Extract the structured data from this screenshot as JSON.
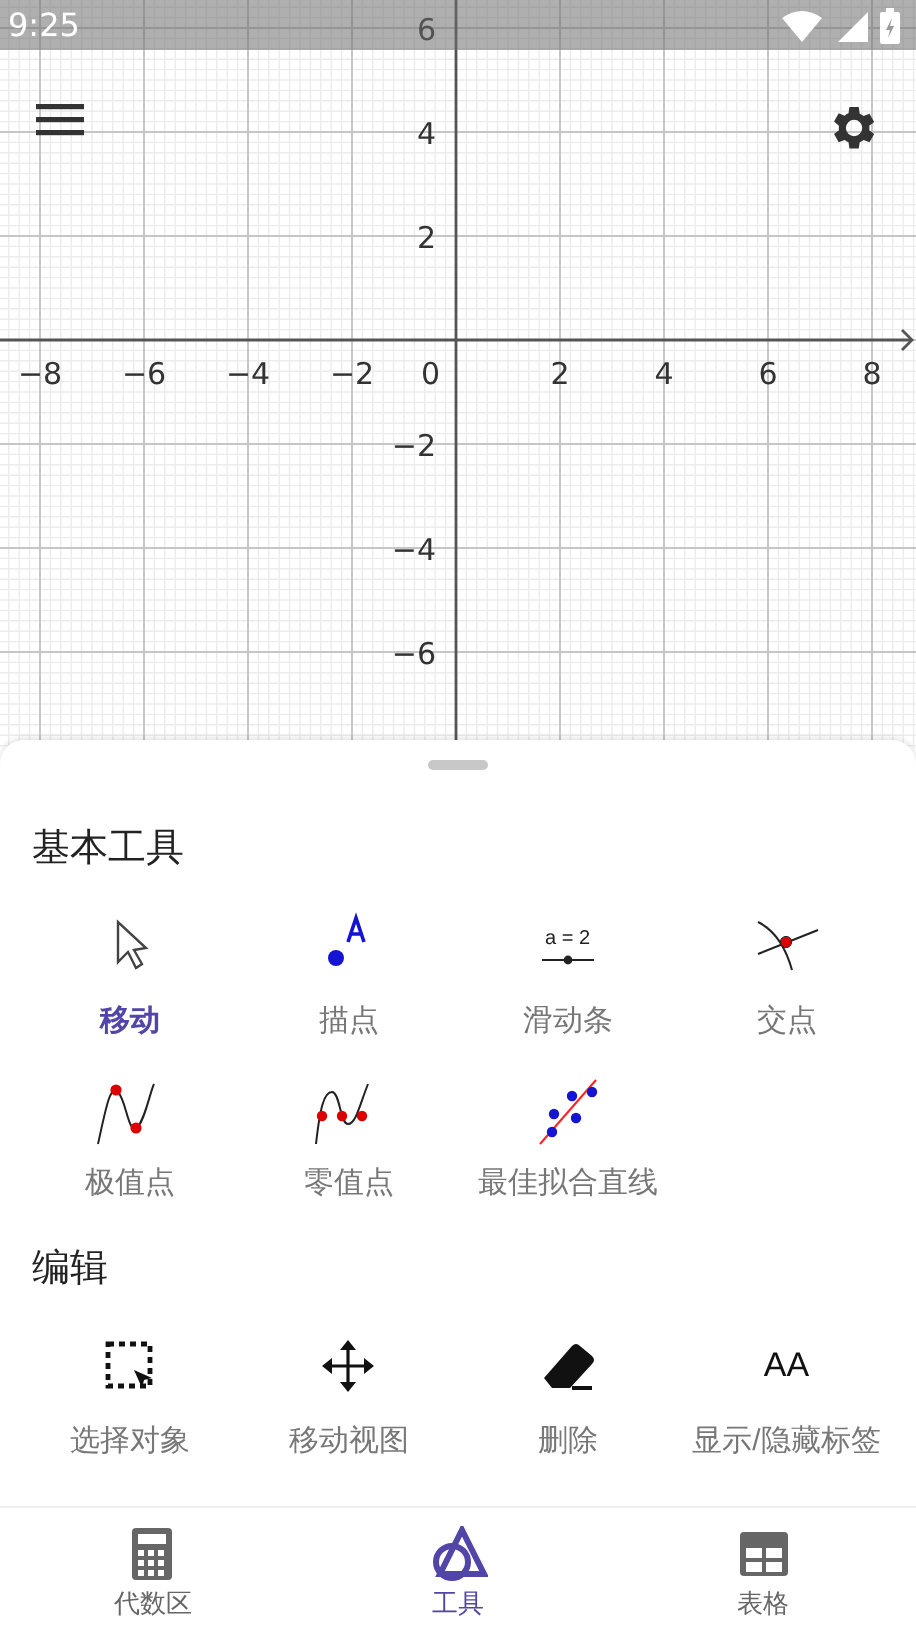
{
  "status_bar": {
    "time": "9:25"
  },
  "graph": {
    "x_ticks": [
      "−8",
      "−6",
      "−4",
      "−2",
      "2",
      "4",
      "6",
      "8"
    ],
    "origin_label": "0",
    "y_ticks": [
      "6",
      "4",
      "2",
      "−2",
      "−4",
      "−6"
    ]
  },
  "sections": [
    {
      "title": "基本工具",
      "tools": [
        {
          "kind": "move",
          "label": "移动",
          "selected": true
        },
        {
          "kind": "point",
          "label": "描点",
          "selected": false
        },
        {
          "kind": "slider",
          "label": "滑动条",
          "selected": false,
          "icon_text": "a = 2"
        },
        {
          "kind": "intersect",
          "label": "交点",
          "selected": false
        },
        {
          "kind": "extremum",
          "label": "极值点",
          "selected": false
        },
        {
          "kind": "roots",
          "label": "零值点",
          "selected": false
        },
        {
          "kind": "fitline",
          "label": "最佳拟合直线",
          "selected": false
        }
      ]
    },
    {
      "title": "编辑",
      "tools": [
        {
          "kind": "select",
          "label": "选择对象",
          "selected": false
        },
        {
          "kind": "pan",
          "label": "移动视图",
          "selected": false
        },
        {
          "kind": "delete",
          "label": "删除",
          "selected": false
        },
        {
          "kind": "labels",
          "label": "显示/隐藏标签",
          "selected": false,
          "icon_text": "AA"
        }
      ]
    }
  ],
  "nav": [
    {
      "kind": "algebra",
      "label": "代数区",
      "selected": false
    },
    {
      "kind": "tools",
      "label": "工具",
      "selected": true
    },
    {
      "kind": "table",
      "label": "表格",
      "selected": false
    }
  ]
}
